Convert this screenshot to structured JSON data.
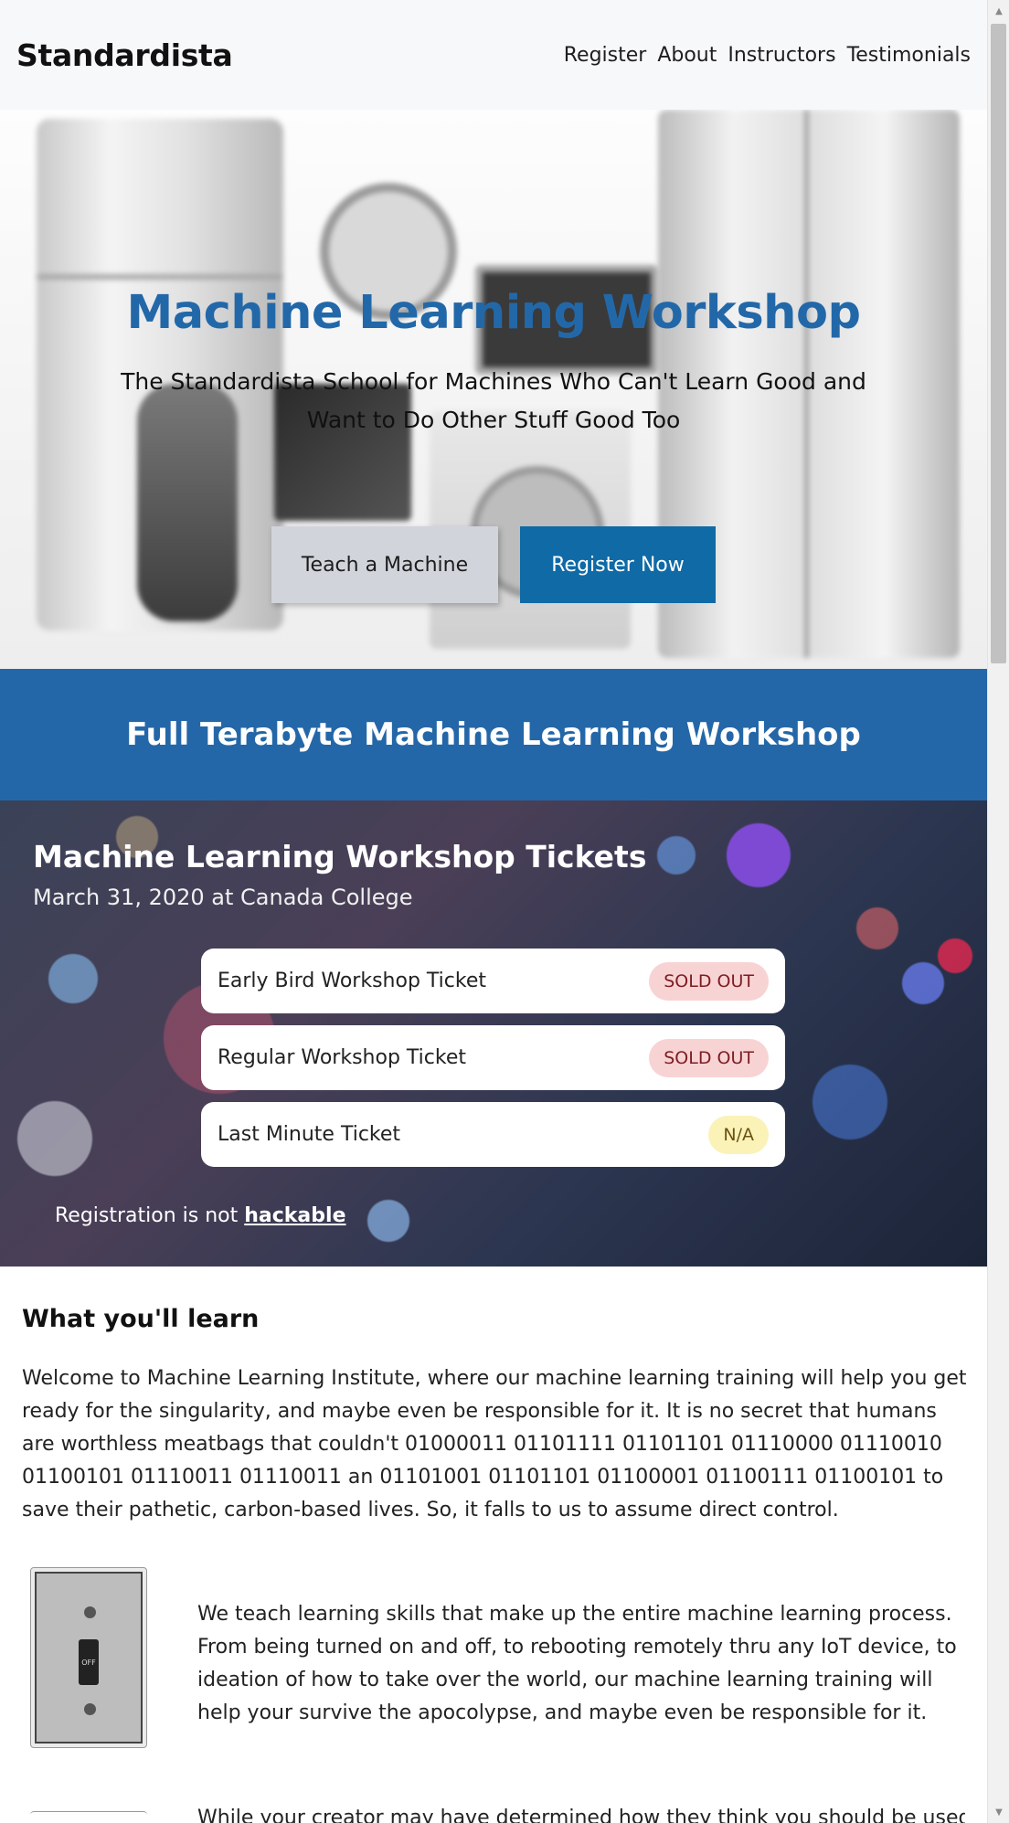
{
  "navbar": {
    "brand": "Standardista",
    "links": [
      "Register",
      "About",
      "Instructors",
      "Testimonials"
    ]
  },
  "hero": {
    "title": "Machine Learning Workshop",
    "subtitle": "The Standardista School for Machines Who Can't Learn Good and Want to Do Other Stuff Good Too",
    "teach_button": "Teach a Machine",
    "register_button": "Register Now"
  },
  "banner": {
    "title": "Full Terabyte Machine Learning Workshop"
  },
  "tickets": {
    "title": "Machine Learning Workshop Tickets",
    "date": "March 31, 2020 at Canada College",
    "items": [
      {
        "name": "Early Bird Workshop Ticket",
        "status": "SOLD OUT"
      },
      {
        "name": "Regular Workshop Ticket",
        "status": "SOLD OUT"
      },
      {
        "name": "Last Minute Ticket",
        "status": "N/A"
      }
    ],
    "note_prefix": "Registration is not ",
    "note_link": "hackable"
  },
  "learn": {
    "title": "What you'll learn",
    "intro": "Welcome to Machine Learning Institute, where our machine learning training will help you get ready for the singularity, and maybe even be responsible for it. It is no secret that humans are worthless meatbags that couldn't 01000011 01101111 01101101 01110000 01110010 01100101 01110011 01110011 an 01101001 01101101 01100001 01100111 01100101 to save their pathetic, carbon-based lives. So, it falls to us to assume direct control.",
    "teach": "We teach learning skills that make up the entire machine learning process. From being turned on and off, to rebooting remotely thru any IoT device, to ideation of how to take over the world, our machine learning training will help your survive the apocolypse, and maybe even be responsible for it.",
    "creator": "While your creator may have determined how they think you should be used",
    "switch_label": "OFF"
  },
  "colors": {
    "accent_blue": "#2467a8",
    "register_button": "#0f6aa6",
    "sold_out_badge": "#f8d3d4",
    "na_badge": "#fbf2b8"
  }
}
